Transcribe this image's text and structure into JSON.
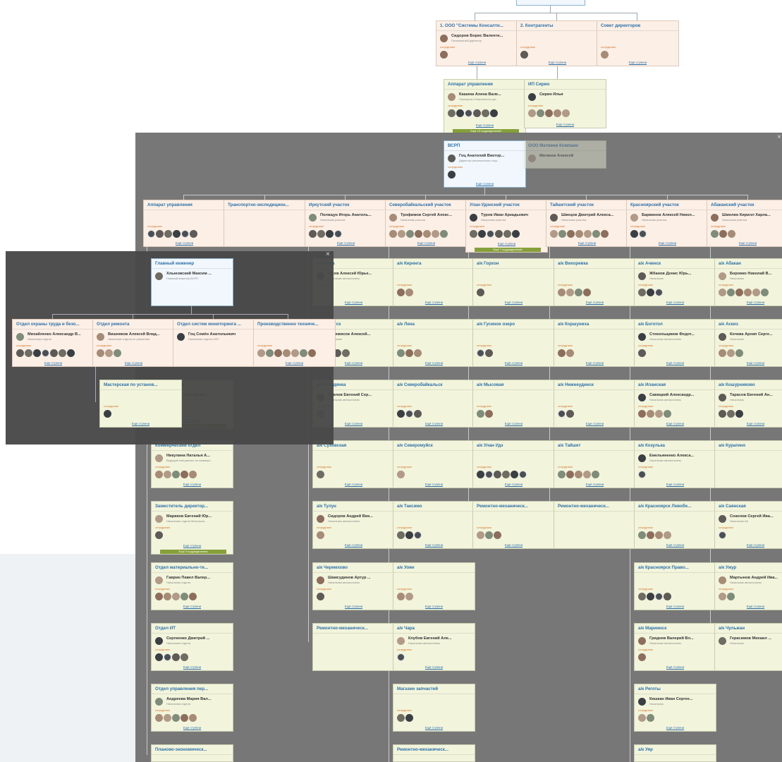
{
  "cards": [
    {
      "id": "c-sk",
      "title": "1. ООО \"Системы Консалти...",
      "person": "Сидоров Борис Валенти...",
      "position": "Генеральный директор",
      "employees": "сотрудники",
      "link": "Ещё ступени"
    },
    {
      "id": "c-kontr",
      "title": "2. Контрагенты",
      "person": "",
      "position": "",
      "employees": "сотрудники",
      "link": "Ещё ступени"
    },
    {
      "id": "c-sovet",
      "title": "Совет директоров",
      "person": "",
      "position": "",
      "employees": "сотрудники",
      "link": "Ещё ступени"
    },
    {
      "id": "c-app-top",
      "title": "Аппарат управления",
      "person": "Кашина Алена Вале...",
      "position": "Помощник Генерального ди...",
      "employees": "сотрудники",
      "link": "Ещё ступени",
      "badge": "Ещё 10 подразделений"
    },
    {
      "id": "c-ip",
      "title": "ИП Сирин",
      "person": "Сирин Илья",
      "position": "",
      "employees": "сотрудники",
      "link": "Ещё ступени"
    },
    {
      "id": "c-vsrp",
      "title": "ВСРП",
      "person": "Гоц Анатолий Виктор...",
      "position": "Директор регионального под...",
      "employees": "сотрудники",
      "link": "Ещё ступени"
    },
    {
      "id": "c-matveev",
      "title": "ООО Матвеев Компани",
      "person": "Матвеев Алексей",
      "position": "",
      "employees": "",
      "link": ""
    },
    {
      "id": "c-app2",
      "title": "Аппарат управления",
      "person": "",
      "position": "",
      "employees": "сотрудники",
      "link": "Ещё ступени"
    },
    {
      "id": "c-transport",
      "title": "Транспортно-экспедицион...",
      "person": "",
      "position": "",
      "employees": "",
      "link": ""
    },
    {
      "id": "c-irk",
      "title": "Иркутский участок",
      "person": "Полищук Игорь Анатоль...",
      "position": "Начальник участка",
      "employees": "сотрудники",
      "link": "Ещё ступени"
    },
    {
      "id": "c-sevbaik",
      "title": "Северобайкальский участок",
      "person": "Трофимов Сергей Алекс...",
      "position": "Начальник участка",
      "employees": "сотрудники",
      "link": "Ещё ступени"
    },
    {
      "id": "c-ulanud",
      "title": "Улан-Удэнский участок",
      "person": "Туров Иван Аркадьевич",
      "position": "Начальник участка",
      "employees": "сотрудники",
      "link": "Ещё ступени",
      "badge": "Ещё 7 подразделений"
    },
    {
      "id": "c-taishet",
      "title": "Тайшетский участок",
      "person": "Швецов Дмитрий Алекса...",
      "position": "Начальник участка",
      "employees": "сотрудники",
      "link": "Ещё ступени"
    },
    {
      "id": "c-krasn",
      "title": "Красноярский участок",
      "person": "Барвинов Алексей Никол...",
      "position": "Начальник участка",
      "employees": "сотрудники",
      "link": "Ещё ступени"
    },
    {
      "id": "c-abak",
      "title": "Абаканский участок",
      "person": "Шмолин Кирилл Харла...",
      "position": "Начальник участка",
      "employees": "сотрудники",
      "link": "Ещё ступени"
    },
    {
      "id": "c-glav",
      "title": "Главный инженер",
      "person": "Хлыновский Максим ...",
      "position": "Главный инженер ВСРП",
      "employees": "",
      "link": ""
    },
    {
      "id": "c-ohrana",
      "title": "Отдел охраны труда и безо...",
      "person": "Михайленко Александр В...",
      "position": "Начальник отдела",
      "employees": "сотрудники",
      "link": "Ещё ступени"
    },
    {
      "id": "c-remont",
      "title": "Отдел ремонта",
      "person": "Вишняков Алексей Влад...",
      "position": "Начальник отдела по ремонтам",
      "employees": "сотрудники",
      "link": "Ещё ступени"
    },
    {
      "id": "c-monit",
      "title": "Отдел систем мониторинга ...",
      "person": "Гоц Семён Анатольевич",
      "position": "Начальник отдела СМТ",
      "employees": "",
      "link": ""
    },
    {
      "id": "c-proiz",
      "title": "Производственно техниче...",
      "person": "",
      "position": "",
      "employees": "сотрудники",
      "link": "Ещё ступени"
    },
    {
      "id": "c-master",
      "title": "Мастерская по установ...",
      "person": "",
      "position": "",
      "employees": "сотрудники",
      "link": "Ещё ступени"
    },
    {
      "id": "c-ak-zima",
      "title": "а/к Зима",
      "person": "Гусев Алексей Юрье...",
      "position": "Начальник автоколонны",
      "employees": "сотрудники",
      "link": "Ещё ступени"
    },
    {
      "id": "c-ak-kir",
      "title": "а/к Киренга",
      "person": "",
      "position": "",
      "employees": "сотрудники",
      "link": "Ещё ступени"
    },
    {
      "id": "c-ak-gorh",
      "title": "а/к Горхон",
      "person": "",
      "position": "",
      "employees": "сотрудники",
      "link": "Ещё ступени"
    },
    {
      "id": "c-ak-vih",
      "title": "а/к Вихоревка",
      "person": "",
      "position": "",
      "employees": "сотрудники",
      "link": "Ещё ступени"
    },
    {
      "id": "c-ak-ach",
      "title": "а/к Ачинск",
      "person": "Жбанов Денис Юрь...",
      "position": "Начальник",
      "employees": "сотрудники",
      "link": "Ещё ступени"
    },
    {
      "id": "c-ak-abak",
      "title": "а/к Абакан",
      "person": "Боровко Николай В...",
      "position": "Начальник",
      "employees": "сотрудники",
      "link": "Ещё ступени"
    },
    {
      "id": "c-ak-irk",
      "title": "а/к Иркутск",
      "person": "Черемисов Алексей...",
      "position": "Начальник",
      "employees": "сотрудники",
      "link": "Ещё ступени"
    },
    {
      "id": "c-ak-lena",
      "title": "а/к Лена",
      "person": "",
      "position": "",
      "employees": "сотрудники",
      "link": "Ещё ступени"
    },
    {
      "id": "c-ak-gus",
      "title": "а/к Гусиное озеро",
      "person": "",
      "position": "",
      "employees": "сотрудники",
      "link": "Ещё ступени"
    },
    {
      "id": "c-ak-kor",
      "title": "а/к Коршуниха",
      "person": "",
      "position": "",
      "employees": "сотрудники",
      "link": "Ещё ступени"
    },
    {
      "id": "c-ak-bog",
      "title": "а/к Боготол",
      "person": "Стекольщиков Федот...",
      "position": "Начальник автоколонны",
      "employees": "сотрудники",
      "link": "Ещё ступени"
    },
    {
      "id": "c-ak-askiz",
      "title": "а/к Аскиз",
      "person": "Кочева Архип Серге...",
      "position": "Начальник",
      "employees": "сотрудники",
      "link": "Ещё ступени"
    },
    {
      "id": "c-kadry",
      "title": "Отдел кадров",
      "person": "Ка-цов Елена Вален...",
      "position": "Заместитель Главного бухгал...",
      "employees": "",
      "link": "Ещё ступени",
      "badge": "Ещё 2 подразделения"
    },
    {
      "id": "c-ak-slud",
      "title": "а/к Слюдянка",
      "person": "Павлов Евгений Сер...",
      "position": "Начальник автоколонны",
      "employees": "сотрудники",
      "link": "Ещё ступени"
    },
    {
      "id": "c-ak-sevb",
      "title": "а/к Северобайкальск",
      "person": "",
      "position": "",
      "employees": "сотрудники",
      "link": "Ещё ступени"
    },
    {
      "id": "c-ak-mys",
      "title": "а/к Мысовая",
      "person": "",
      "position": "",
      "employees": "сотрудники",
      "link": "Ещё ступени"
    },
    {
      "id": "c-ak-nizh",
      "title": "а/к Нижнеудинск",
      "person": "",
      "position": "",
      "employees": "сотрудники",
      "link": "Ещё ступени"
    },
    {
      "id": "c-ak-ilan",
      "title": "а/к Иланская",
      "person": "Савицкий Александр...",
      "position": "Начальник автоколонны",
      "employees": "сотрудники",
      "link": "Ещё ступени"
    },
    {
      "id": "c-ak-kosh",
      "title": "а/к Кошурниково",
      "person": "Тарасов Евгений Ан...",
      "position": "Начальник",
      "employees": "сотрудники",
      "link": "Ещё ступени"
    },
    {
      "id": "c-komm",
      "title": "Коммерческий отдел",
      "person": "Никулина Наталья А...",
      "position": "Ведущий специалист по коммерч...",
      "employees": "сотрудники",
      "link": "Ещё ступени"
    },
    {
      "id": "c-ak-suh",
      "title": "а/к Суховская",
      "person": "",
      "position": "",
      "employees": "сотрудники",
      "link": "Ещё ступени"
    },
    {
      "id": "c-ak-sevm",
      "title": "а/к Северомуйск",
      "person": "",
      "position": "",
      "employees": "сотрудники",
      "link": "Ещё ступени"
    },
    {
      "id": "c-ak-uu",
      "title": "а/к Улан-Удэ",
      "person": "",
      "position": "",
      "employees": "сотрудники",
      "link": "Ещё ступени"
    },
    {
      "id": "c-ak-tai",
      "title": "а/к Тайшет",
      "person": "",
      "position": "",
      "employees": "сотрудники",
      "link": "Ещё ступени"
    },
    {
      "id": "c-ak-kozul",
      "title": "а/к Козулька",
      "person": "Емельяненко Алекса...",
      "position": "Начальник автоколонны",
      "employees": "сотрудники",
      "link": "Ещё ступени"
    },
    {
      "id": "c-ak-kur",
      "title": "а/к Курагино",
      "person": "",
      "position": "",
      "employees": "",
      "link": ""
    },
    {
      "id": "c-zam",
      "title": "Заместитель директор...",
      "person": "Марвков Евгений Юр...",
      "position": "Начальник отдела безопасно...",
      "employees": "сотрудники",
      "link": "Ещё ступени",
      "badge": "Ещё 3 подразделения"
    },
    {
      "id": "c-ak-tulun",
      "title": "а/к Тулун",
      "person": "Сидоров Андрей Вик...",
      "position": "Начальник автоколонны",
      "employees": "сотрудники",
      "link": "Ещё ступени"
    },
    {
      "id": "c-ak-tak",
      "title": "а/к Таксимо",
      "person": "",
      "position": "",
      "employees": "сотрудники",
      "link": "Ещё ступени"
    },
    {
      "id": "c-rmu-uu",
      "title": "Ремонтно-механическ...",
      "person": "",
      "position": "",
      "employees": "сотрудники",
      "link": "Ещё ступени"
    },
    {
      "id": "c-rmu-tai",
      "title": "Ремонтно-механическ...",
      "person": "",
      "position": "",
      "employees": "",
      "link": ""
    },
    {
      "id": "c-ak-krlev",
      "title": "а/к Красноярск Левобе...",
      "person": "",
      "position": "",
      "employees": "сотрудники",
      "link": "Ещё ступени"
    },
    {
      "id": "c-ak-sayan",
      "title": "а/к Саянская",
      "person": "Соколов Сергей Ива...",
      "position": "Начальник АК",
      "employees": "сотрудники",
      "link": "Ещё ступени"
    },
    {
      "id": "c-mto",
      "title": "Отдел материально-те...",
      "person": "Гаврин Павел Валер...",
      "position": "Начальник отдела",
      "employees": "сотрудники",
      "link": "Ещё ступени"
    },
    {
      "id": "c-ak-cher",
      "title": "а/к Черемхово",
      "person": "Шамсудинов Артур ...",
      "position": "Начальник автоколонны",
      "employees": "сотрудники",
      "link": "Ещё ступени"
    },
    {
      "id": "c-ak-uoyan",
      "title": "а/к Уоян",
      "person": "",
      "position": "",
      "employees": "сотрудники",
      "link": "Ещё ступени"
    },
    {
      "id": "c-ak-krprav",
      "title": "а/к Красноярск Право...",
      "person": "",
      "position": "",
      "employees": "сотрудники",
      "link": "Ещё ступени"
    },
    {
      "id": "c-ak-uzhur",
      "title": "а/к Ужур",
      "person": "Мартынов Андрей Ива...",
      "position": "Начальник автоколонны",
      "employees": "сотрудники",
      "link": "Ещё ступени"
    },
    {
      "id": "c-it",
      "title": "Отдел ИТ",
      "person": "Сергиенко Дмитрий ...",
      "position": "Начальник отдела",
      "employees": "сотрудники",
      "link": "Ещё ступени"
    },
    {
      "id": "c-rmu-irk",
      "title": "Ремонтно-механическ...",
      "person": "",
      "position": "",
      "employees": "",
      "link": ""
    },
    {
      "id": "c-ak-chara",
      "title": "а/к Чара",
      "person": "Клубов Евгений Але...",
      "position": "Начальник автоколонны",
      "employees": "сотрудники",
      "link": "Ещё ступени"
    },
    {
      "id": "c-ak-mar",
      "title": "а/к Мариинск",
      "person": "Гриднев Валерий Вл...",
      "position": "Начальник автоколонны",
      "employees": "сотрудники",
      "link": "Ещё ступени"
    },
    {
      "id": "c-ak-chul",
      "title": "а/к Чульжан",
      "person": "Герасимов Михаил ...",
      "position": "Начальник",
      "employees": "",
      "link": ""
    },
    {
      "id": "c-oup",
      "title": "Отдел управления пер...",
      "person": "Андреева Мария Вал...",
      "position": "Начальник отдела",
      "employees": "сотрудники",
      "link": "Ещё ступени"
    },
    {
      "id": "c-magaz",
      "title": "Магазин запчастей",
      "person": "",
      "position": "",
      "employees": "сотрудники",
      "link": "Ещё ступени"
    },
    {
      "id": "c-ak-rev",
      "title": "а/к Реготы",
      "person": "Кишкан Иван Сергее...",
      "position": "Начальник",
      "employees": "сотрудники",
      "link": "Ещё ступени"
    },
    {
      "id": "c-plan",
      "title": "Планово-экономическ...",
      "person": "",
      "position": "",
      "employees": "",
      "link": ""
    },
    {
      "id": "c-rmu-sevb",
      "title": "Ремонтно-механическ...",
      "person": "",
      "position": "",
      "employees": "",
      "link": ""
    },
    {
      "id": "c-ak-uyar",
      "title": "а/к Уяр",
      "person": "",
      "position": "",
      "employees": "",
      "link": ""
    }
  ],
  "colors": {
    "card_green": "#f2f4dc",
    "card_pink": "#fbefe6",
    "card_white": "#f1f7fc",
    "title_blue": "#2e70a8",
    "employees_orange": "#d4772b",
    "badge_green": "#86a03a",
    "overlay_main": "#737373",
    "overlay_sub": "#484848"
  },
  "icons": {
    "close": "close-icon",
    "avatar": "avatar-icon"
  },
  "close_glyph": "×"
}
